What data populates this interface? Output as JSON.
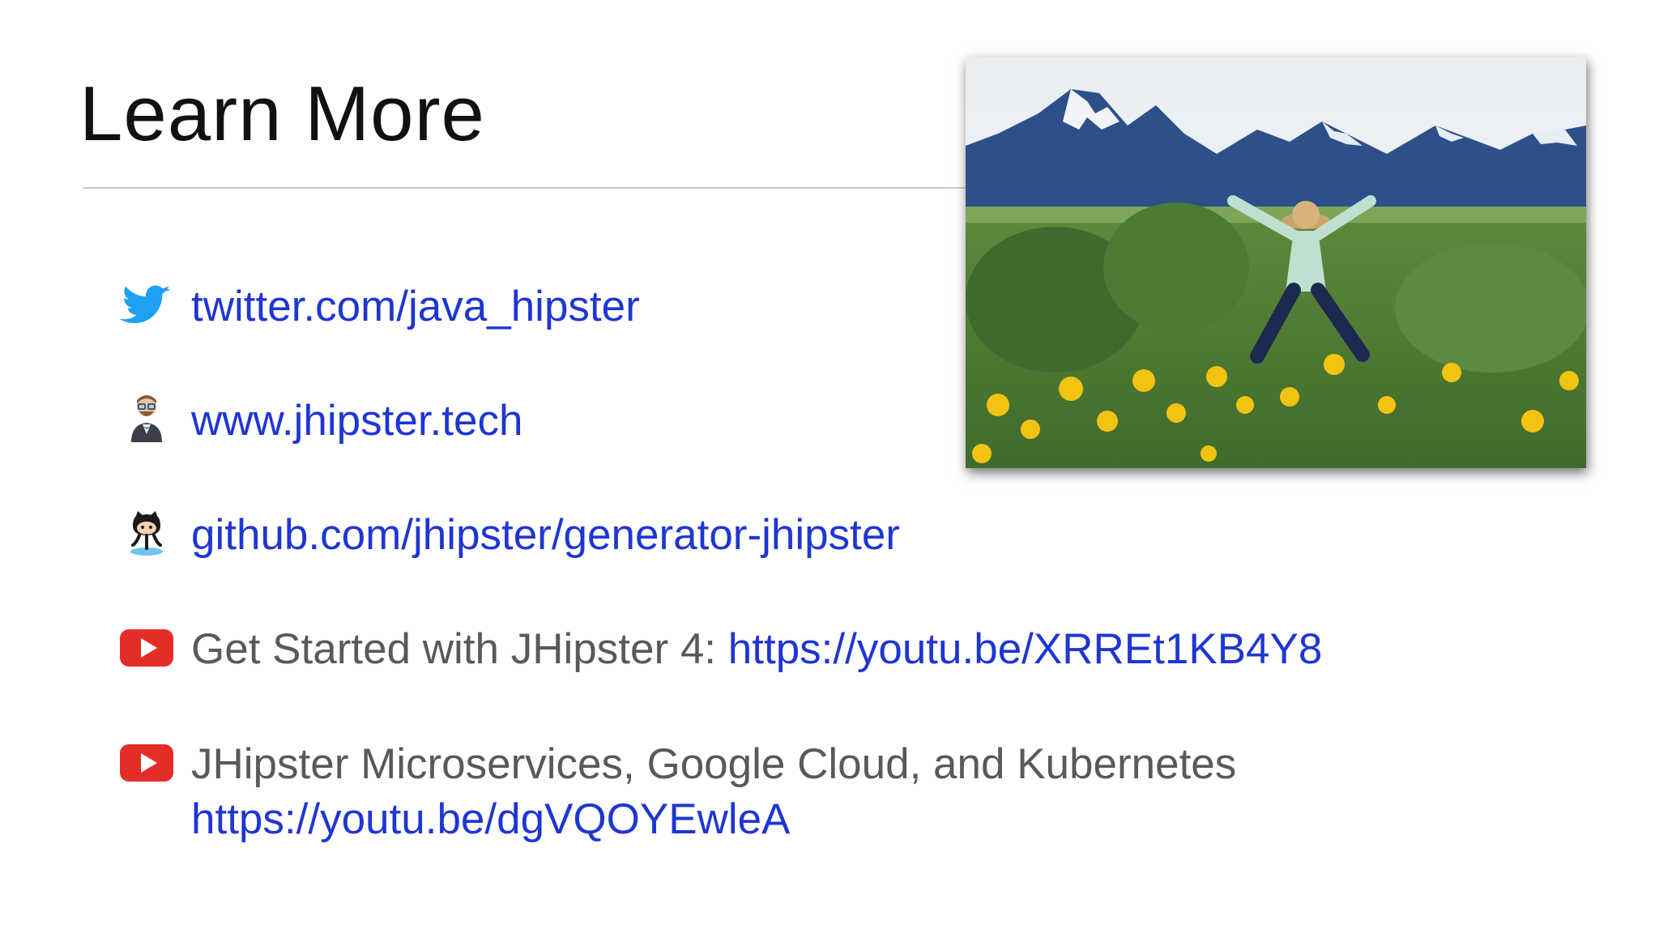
{
  "slide": {
    "title": "Learn More"
  },
  "links": {
    "twitter": {
      "icon": "twitter-bird-icon",
      "url": "twitter.com/java_hipster"
    },
    "website": {
      "icon": "jhipster-mascot-icon",
      "url": "www.jhipster.tech"
    },
    "github": {
      "icon": "github-octocat-icon",
      "url": "github.com/jhipster/generator-jhipster"
    },
    "video1": {
      "icon": "youtube-play-icon",
      "label": "Get Started with JHipster 4: ",
      "url": "https://youtu.be/XRREt1KB4Y8"
    },
    "video2": {
      "icon": "youtube-play-icon",
      "label": "JHipster Microservices, Google Cloud, and Kubernetes",
      "url": "https://youtu.be/dgVQOYEwleA"
    }
  },
  "colors": {
    "link": "#1f36d3",
    "text": "#595959",
    "youtube_red": "#e52d27",
    "twitter_blue": "#1da1f2"
  }
}
